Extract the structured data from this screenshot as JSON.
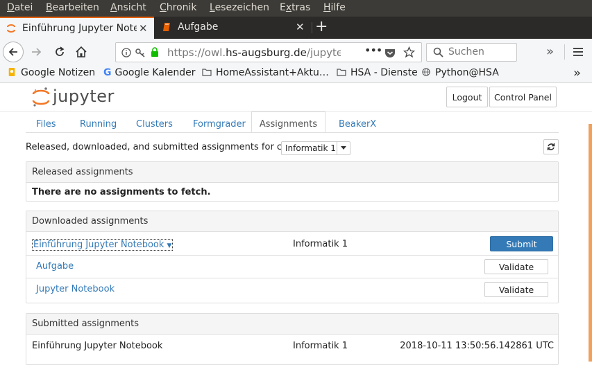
{
  "menubar": {
    "items": [
      "Datei",
      "Bearbeiten",
      "Ansicht",
      "Chronik",
      "Lesezeichen",
      "Extras",
      "Hilfe"
    ],
    "accesskeys": [
      "D",
      "B",
      "A",
      "C",
      "L",
      "x",
      "H"
    ]
  },
  "tabs": [
    {
      "title": "Einführung Jupyter Notebook",
      "active": true
    },
    {
      "title": "Aufgabe",
      "active": false
    }
  ],
  "navbar": {
    "url_prefix": "https://owl.",
    "url_domain": "hs-augsburg.de",
    "url_path": "/jupyter/u",
    "search_placeholder": "Suchen"
  },
  "bookmarks": [
    "Google Notizen",
    "Google Kalender",
    "HomeAssistant+Aktu…",
    "HSA - Dienste",
    "Python@HSA"
  ],
  "header": {
    "logo_text": "jupyter",
    "logout_label": "Logout",
    "control_panel_label": "Control Panel"
  },
  "nav_tabs": [
    "Files",
    "Running",
    "Clusters",
    "Formgrader",
    "Assignments",
    "BeakerX"
  ],
  "course": {
    "label": "Released, downloaded, and submitted assignments for course:",
    "selected": "Informatik 1"
  },
  "released": {
    "title": "Released assignments",
    "empty_message": "There are no assignments to fetch."
  },
  "downloaded": {
    "title": "Downloaded assignments",
    "assignment": {
      "name": "Einführung Jupyter Notebook",
      "course": "Informatik 1",
      "submit_label": "Submit"
    },
    "notebooks": [
      {
        "name": "Aufgabe",
        "validate_label": "Validate"
      },
      {
        "name": "Jupyter Notebook",
        "validate_label": "Validate"
      }
    ]
  },
  "submitted": {
    "title": "Submitted assignments",
    "rows": [
      {
        "name": "Einführung Jupyter Notebook",
        "course": "Informatik 1",
        "timestamp": "2018-10-11 13:50:56.142861 UTC"
      }
    ]
  },
  "colors": {
    "firefox_accent": "#e66000",
    "link": "#337ab7",
    "primary_button": "#337ab7",
    "jupyter_orange": "#f37726"
  },
  "icons": [
    "back-arrow-icon",
    "forward-arrow-icon",
    "reload-icon",
    "home-icon",
    "info-icon",
    "key-icon",
    "lock-icon",
    "page-actions-icon",
    "pocket-icon",
    "bookmark-star-icon",
    "search-icon",
    "overflow-chevron-icon",
    "hamburger-menu-icon",
    "refresh-icon",
    "caret-down-icon"
  ]
}
